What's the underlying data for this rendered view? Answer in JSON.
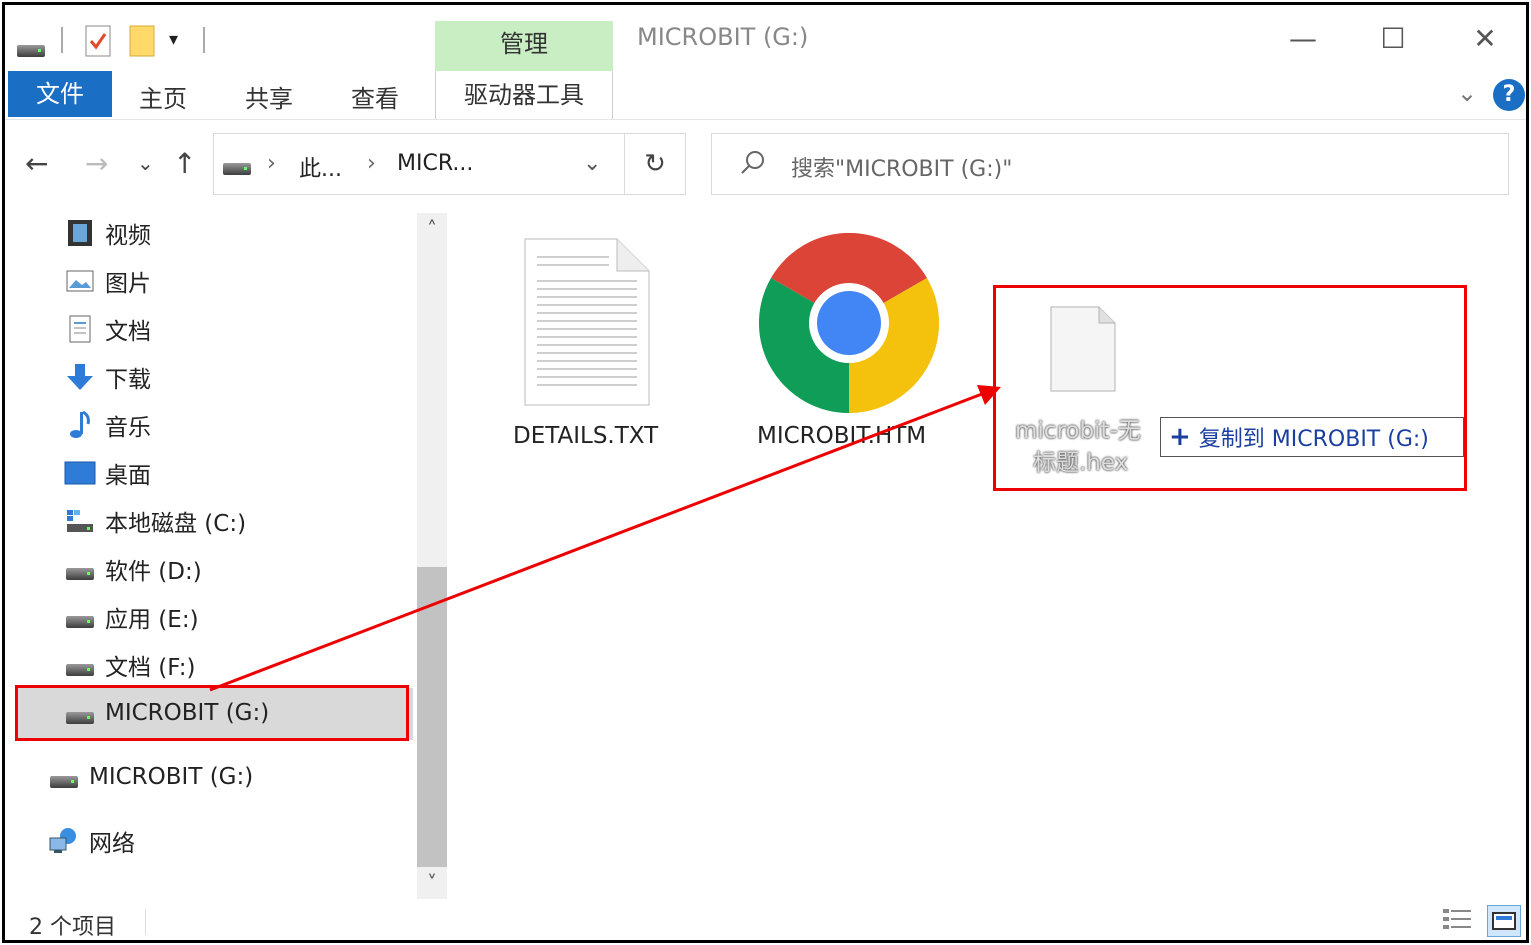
{
  "titlebar": {
    "window_title": "MICROBIT (G:)",
    "manage_tab": "管理",
    "minimize": "—",
    "maximize": "☐",
    "close": "✕"
  },
  "ribbon": {
    "file_tab": "文件",
    "home_tab": "主页",
    "share_tab": "共享",
    "view_tab": "查看",
    "drive_tools_tab": "驱动器工具",
    "expand_glyph": "⌄",
    "help": "?"
  },
  "navbar": {
    "back": "←",
    "forward": "→",
    "recent": "⌄",
    "up": "↑",
    "crumb_1": "此...",
    "crumb_2": "MICR...",
    "sep": "›",
    "dropdown": "⌄",
    "refresh": "↻",
    "search_placeholder": "搜索\"MICROBIT (G:)\""
  },
  "sidebar": {
    "items": [
      {
        "label": "视频",
        "icon": "video-icon"
      },
      {
        "label": "图片",
        "icon": "pictures-icon"
      },
      {
        "label": "文档",
        "icon": "documents-icon"
      },
      {
        "label": "下载",
        "icon": "download-icon"
      },
      {
        "label": "音乐",
        "icon": "music-icon"
      },
      {
        "label": "桌面",
        "icon": "desktop-icon"
      },
      {
        "label": "本地磁盘 (C:)",
        "icon": "local-disk-icon"
      },
      {
        "label": "软件 (D:)",
        "icon": "drive-icon"
      },
      {
        "label": "应用 (E:)",
        "icon": "drive-icon"
      },
      {
        "label": "文档 (F:)",
        "icon": "drive-icon"
      },
      {
        "label": "MICROBIT (G:)",
        "icon": "drive-icon"
      },
      {
        "label": "MICROBIT (G:)",
        "icon": "drive-icon"
      },
      {
        "label": "网络",
        "icon": "network-icon"
      }
    ],
    "scroll_up": "˄",
    "scroll_down": "˅"
  },
  "files": {
    "items": [
      {
        "name": "DETAILS.TXT",
        "icon": "text-file-icon"
      },
      {
        "name": "MICROBIT.HTM",
        "icon": "chrome-icon"
      }
    ],
    "dragged_file": {
      "line1": "microbit-无",
      "line2": "标题.hex",
      "icon": "blank-file-icon"
    },
    "copy_tooltip": "复制到 MICROBIT (G:)",
    "copy_plus": "+"
  },
  "status": {
    "item_count": "2 个项目"
  },
  "colors": {
    "accent": "#1a6fc4",
    "manage_tab_bg": "#c9eec3",
    "highlight_red": "#e00000",
    "selected_bg": "#d9d9d9"
  }
}
